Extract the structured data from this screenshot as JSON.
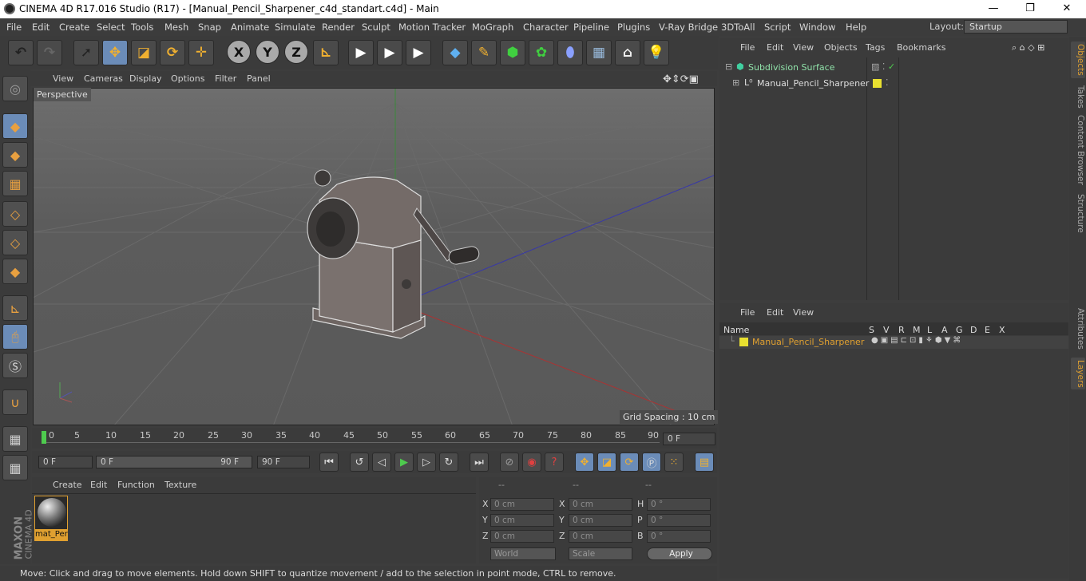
{
  "window": {
    "title": "CINEMA 4D R17.016 Studio (R17) - [Manual_Pencil_Sharpener_c4d_standart.c4d] - Main",
    "min": "—",
    "max": "❐",
    "close": "✕"
  },
  "menubar": [
    "File",
    "Edit",
    "Create",
    "Select",
    "Tools",
    "Mesh",
    "Snap",
    "Animate",
    "Simulate",
    "Render",
    "Sculpt",
    "Motion Tracker",
    "MoGraph",
    "Character",
    "Pipeline",
    "Plugins",
    "V-Ray Bridge",
    "3DToAll",
    "Script",
    "Window",
    "Help"
  ],
  "layout": {
    "label": "Layout:",
    "value": "Startup"
  },
  "toolbar": {
    "x": "X",
    "y": "Y",
    "z": "Z"
  },
  "viewport": {
    "menu": [
      "View",
      "Cameras",
      "Display",
      "Options",
      "Filter",
      "Panel"
    ],
    "label": "Perspective",
    "grid": "Grid Spacing : 10 cm"
  },
  "timeline": {
    "ticks": [
      "0",
      "5",
      "10",
      "15",
      "20",
      "25",
      "30",
      "35",
      "40",
      "45",
      "50",
      "55",
      "60",
      "65",
      "70",
      "75",
      "80",
      "85",
      "90"
    ],
    "frame": "0 F"
  },
  "playbar": {
    "start": "0 F",
    "range_start": "0 F",
    "range_end": "90 F",
    "end": "90 F"
  },
  "material": {
    "menu": [
      "Create",
      "Edit",
      "Function",
      "Texture"
    ],
    "name": "mat_Per"
  },
  "coords": {
    "head": [
      "--",
      "--",
      "--"
    ],
    "rows": [
      {
        "a": "X",
        "av": "0 cm",
        "b": "X",
        "bv": "0 cm",
        "c": "H",
        "cv": "0 °"
      },
      {
        "a": "Y",
        "av": "0 cm",
        "b": "Y",
        "bv": "0 cm",
        "c": "P",
        "cv": "0 °"
      },
      {
        "a": "Z",
        "av": "0 cm",
        "b": "Z",
        "bv": "0 cm",
        "c": "B",
        "cv": "0 °"
      }
    ],
    "world": "World",
    "scale": "Scale",
    "apply": "Apply"
  },
  "objects": {
    "menu": [
      "File",
      "Edit",
      "View",
      "Objects",
      "Tags",
      "Bookmarks"
    ],
    "items": [
      "Subdivision Surface",
      "Manual_Pencil_Sharpener"
    ]
  },
  "layers": {
    "menu": [
      "File",
      "Edit",
      "View"
    ],
    "cols": [
      "Name",
      "S",
      "V",
      "R",
      "M",
      "L",
      "A",
      "G",
      "D",
      "E",
      "X"
    ],
    "item": "Manual_Pencil_Sharpener"
  },
  "tabs": [
    "Objects",
    "Takes",
    "Content Browser",
    "Structure",
    "Attributes",
    "Layers"
  ],
  "status": "Move: Click and drag to move elements. Hold down SHIFT to quantize movement / add to the selection in point mode, CTRL to remove.",
  "logo": {
    "maxon": "MAXON",
    "cinema": "CINEMA 4D"
  }
}
